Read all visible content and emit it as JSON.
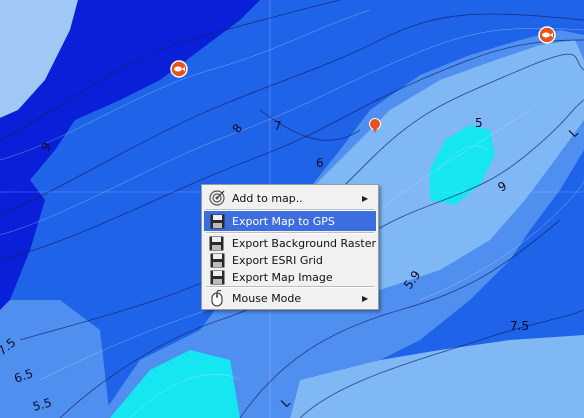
{
  "map": {
    "depth_labels": [
      "9",
      "8",
      "7",
      "6",
      "5",
      "9",
      "5.9",
      "7.5",
      "7.5",
      "6.5",
      "5.5",
      "L",
      "L"
    ],
    "colors": {
      "deep": "#0a1fd8",
      "mid": "#1f63e8",
      "shallow": "#4f8ff0",
      "shallower": "#7fb8f5",
      "shoal": "#16e6f2",
      "land": "#9fc8f5"
    },
    "markers": [
      {
        "type": "fish-icon"
      },
      {
        "type": "fish-icon"
      },
      {
        "type": "waypoint-pin-icon"
      }
    ]
  },
  "context_menu": {
    "items": [
      {
        "label": "Add to map..",
        "icon": "target-icon",
        "submenu": true
      },
      {
        "label": "Export Map to GPS",
        "icon": "floppy-disk-icon",
        "highlighted": true
      },
      {
        "label": "Export Background Raster",
        "icon": "floppy-disk-icon"
      },
      {
        "label": "Export ESRI Grid",
        "icon": "floppy-disk-icon"
      },
      {
        "label": "Export Map Image",
        "icon": "floppy-disk-icon"
      },
      {
        "label": "Mouse Mode",
        "icon": "mouse-icon",
        "submenu": true
      }
    ]
  }
}
